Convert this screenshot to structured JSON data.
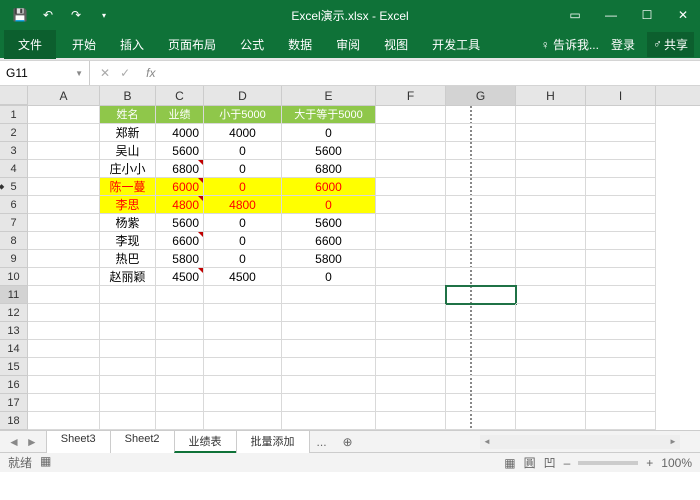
{
  "title": "Excel演示.xlsx - Excel",
  "ribbon": {
    "file": "文件",
    "tabs": [
      "开始",
      "插入",
      "页面布局",
      "公式",
      "数据",
      "审阅",
      "视图",
      "开发工具"
    ],
    "tellme": "告诉我...",
    "login": "登录",
    "share": "共享"
  },
  "namebox": "G11",
  "columns": [
    "A",
    "B",
    "C",
    "D",
    "E",
    "F",
    "G",
    "H",
    "I"
  ],
  "header": {
    "b": "姓名",
    "c": "业绩",
    "d": "小于5000",
    "e": "大于等于5000"
  },
  "rows": [
    {
      "b": "郑新",
      "c": "4000",
      "d": "4000",
      "e": "0",
      "tri": false,
      "hl": false
    },
    {
      "b": "吴山",
      "c": "5600",
      "d": "0",
      "e": "5600",
      "tri": false,
      "hl": false
    },
    {
      "b": "庄小小",
      "c": "6800",
      "d": "0",
      "e": "6800",
      "tri": true,
      "hl": false
    },
    {
      "b": "陈一蔓",
      "c": "6000",
      "d": "0",
      "e": "6000",
      "tri": true,
      "hl": true
    },
    {
      "b": "李思",
      "c": "4800",
      "d": "4800",
      "e": "0",
      "tri": true,
      "hl": true
    },
    {
      "b": "杨紫",
      "c": "5600",
      "d": "0",
      "e": "5600",
      "tri": false,
      "hl": false
    },
    {
      "b": "李现",
      "c": "6600",
      "d": "0",
      "e": "6600",
      "tri": true,
      "hl": false
    },
    {
      "b": "热巴",
      "c": "5800",
      "d": "0",
      "e": "5800",
      "tri": false,
      "hl": false
    },
    {
      "b": "赵丽颖",
      "c": "4500",
      "d": "4500",
      "e": "0",
      "tri": true,
      "hl": false
    }
  ],
  "sheets": {
    "list": [
      "Sheet3",
      "Sheet2",
      "业绩表",
      "批量添加"
    ],
    "active": "业绩表",
    "more": "..."
  },
  "status": {
    "ready": "就绪",
    "zoom": "100%"
  },
  "active_cell": {
    "col": "G",
    "row": 11
  }
}
